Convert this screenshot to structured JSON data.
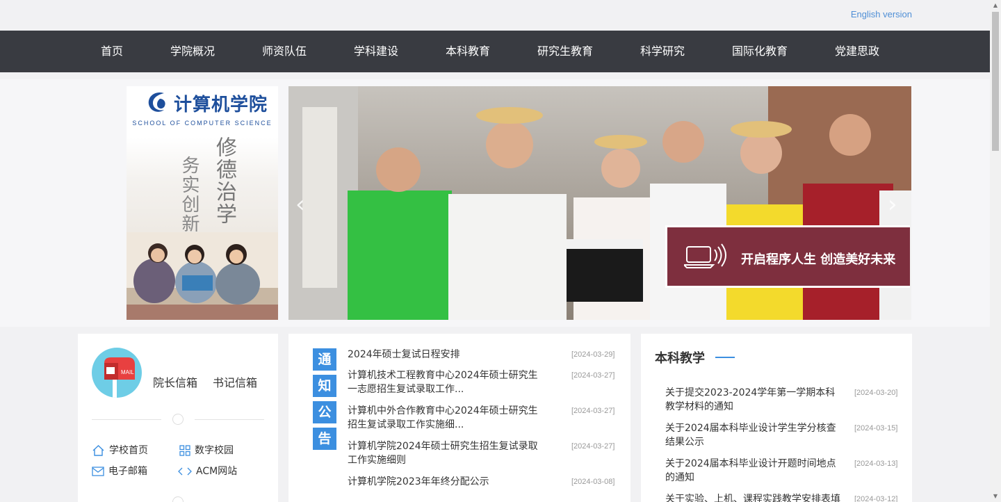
{
  "header": {
    "english_link": "English version"
  },
  "nav": {
    "items": [
      {
        "label": "首页"
      },
      {
        "label": "学院概况"
      },
      {
        "label": "师资队伍"
      },
      {
        "label": "学科建设"
      },
      {
        "label": "本科教育"
      },
      {
        "label": "研究生教育"
      },
      {
        "label": "科学研究"
      },
      {
        "label": "国际化教育"
      },
      {
        "label": "党建思政"
      }
    ]
  },
  "logo": {
    "name_cn": "计算机学院",
    "name_en": "SCHOOL OF COMPUTER SCIENCE",
    "motto_col1": "修德治学",
    "motto_col2": "务实创新"
  },
  "slider": {
    "caption": "开启程序人生 创造美好未来",
    "prev_icon": "chevron-left-icon",
    "next_icon": "chevron-right-icon"
  },
  "mailbox": {
    "avatar_icon": "mailbox-icon",
    "dean_mailbox": "院长信箱",
    "secretary_mailbox": "书记信箱"
  },
  "quick_links": [
    {
      "label": "学校首页",
      "icon": "home-icon"
    },
    {
      "label": "数字校园",
      "icon": "grid-icon"
    },
    {
      "label": "电子邮箱",
      "icon": "envelope-icon"
    },
    {
      "label": "ACM网站",
      "icon": "code-icon"
    }
  ],
  "notices": {
    "tag_chars": [
      "通",
      "知",
      "公",
      "告"
    ],
    "items": [
      {
        "title": "2024年硕士复试日程安排",
        "date": "[2024-03-29]"
      },
      {
        "title": "计算机技术工程教育中心2024年硕士研究生一志愿招生复试录取工作...",
        "date": "[2024-03-27]"
      },
      {
        "title": "计算机中外合作教育中心2024年硕士研究生招生复试录取工作实施细...",
        "date": "[2024-03-27]"
      },
      {
        "title": "计算机学院2024年硕士研究生招生复试录取工作实施细则",
        "date": "[2024-03-27]"
      },
      {
        "title": "计算机学院2023年年终分配公示",
        "date": "[2024-03-08]"
      }
    ]
  },
  "undergrad": {
    "title": "本科教学",
    "items": [
      {
        "title": "关于提交2023-2024学年第一学期本科教学材料的通知",
        "date": "[2024-03-20]"
      },
      {
        "title": "关于2024届本科毕业设计学生学分核查结果公示",
        "date": "[2024-03-15]"
      },
      {
        "title": "关于2024届本科毕业设计开题时间地点的通知",
        "date": "[2024-03-13]"
      },
      {
        "title": "关于实验、上机、课程实践教学安排表填",
        "date": "[2024-03-12]"
      }
    ]
  },
  "colors": {
    "nav_bg": "#393b41",
    "accent_blue": "#3c8fe0",
    "caption_bg": "#7e2f3e",
    "link_blue": "#4f8fd6"
  }
}
